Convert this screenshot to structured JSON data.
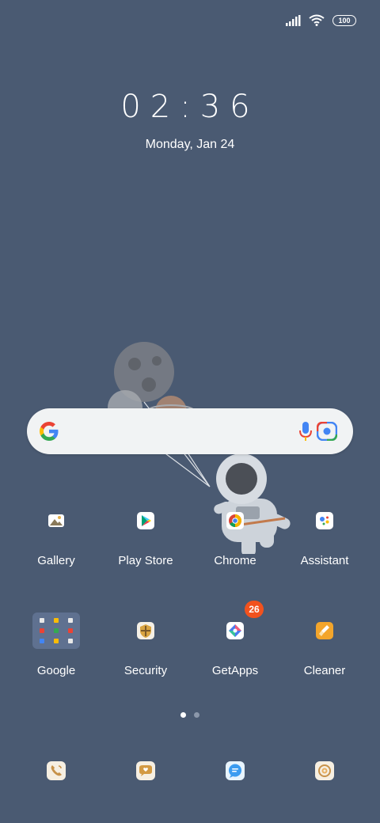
{
  "status": {
    "battery": "100",
    "icons": [
      "signal-icon",
      "wifi-icon",
      "battery-icon"
    ]
  },
  "clock": {
    "time": "02:36",
    "date": "Monday, Jan 24"
  },
  "search": {
    "engine_icon": "google-g-icon",
    "mic_icon": "mic-icon",
    "lens_icon": "lens-icon"
  },
  "apps_row1": [
    {
      "label": "Gallery",
      "icon": "gallery-icon"
    },
    {
      "label": "Play Store",
      "icon": "play-store-icon"
    },
    {
      "label": "Chrome",
      "icon": "chrome-icon"
    },
    {
      "label": "Assistant",
      "icon": "assistant-icon"
    }
  ],
  "apps_row2": [
    {
      "label": "Google",
      "icon": "google-folder-icon"
    },
    {
      "label": "Security",
      "icon": "security-icon"
    },
    {
      "label": "GetApps",
      "icon": "getapps-icon",
      "badge": "26"
    },
    {
      "label": "Cleaner",
      "icon": "cleaner-icon"
    }
  ],
  "pager": {
    "pages": 2,
    "active": 1
  },
  "dock": [
    "phone-icon",
    "messages-icon",
    "chat-icon",
    "camera-icon"
  ],
  "colors": {
    "background": "#4a5a72",
    "badge": "#f2521e"
  }
}
